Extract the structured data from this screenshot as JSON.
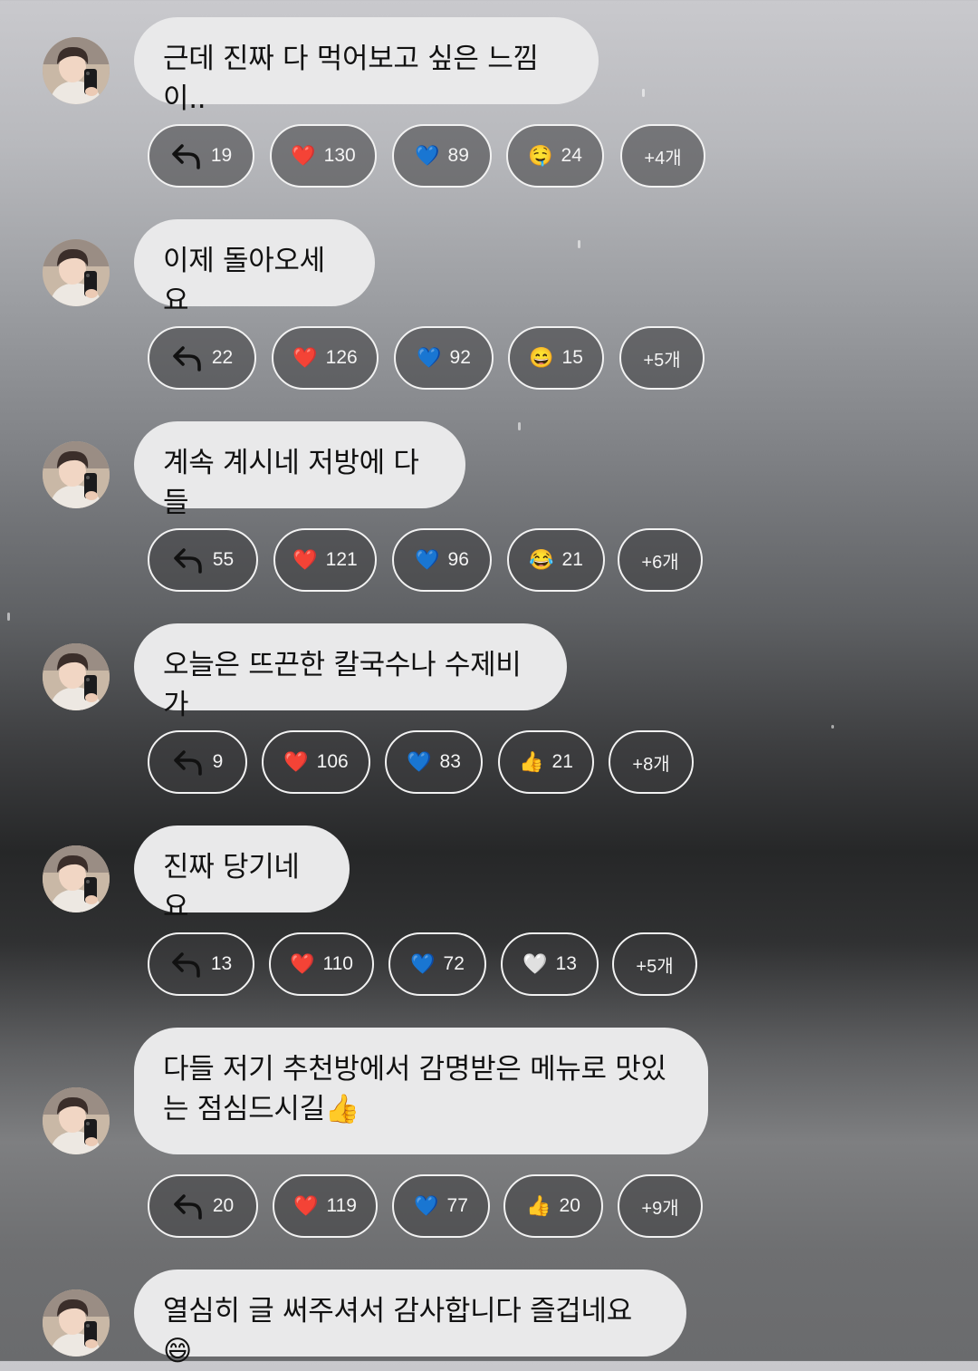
{
  "messages": [
    {
      "text": "근데 진짜 다 먹어보고 싶은 느낌이..",
      "reactions": [
        {
          "type": "reply",
          "icon": "reply-arrow-icon",
          "count": "19"
        },
        {
          "type": "emoji",
          "icon": "red-heart-icon",
          "emoji": "❤️",
          "count": "130"
        },
        {
          "type": "emoji",
          "icon": "blue-heart-icon",
          "emoji": "💙",
          "count": "89"
        },
        {
          "type": "emoji",
          "icon": "drooling-face-icon",
          "emoji": "🤤",
          "count": "24"
        },
        {
          "type": "more",
          "label": "+4개"
        }
      ]
    },
    {
      "text": "이제 돌아오세요",
      "reactions": [
        {
          "type": "reply",
          "icon": "reply-arrow-icon",
          "count": "22"
        },
        {
          "type": "emoji",
          "icon": "red-heart-icon",
          "emoji": "❤️",
          "count": "126"
        },
        {
          "type": "emoji",
          "icon": "blue-heart-icon",
          "emoji": "💙",
          "count": "92"
        },
        {
          "type": "emoji",
          "icon": "grinning-face-icon",
          "emoji": "😄",
          "count": "15"
        },
        {
          "type": "more",
          "label": "+5개"
        }
      ]
    },
    {
      "text": "계속 계시네 저방에 다들",
      "reactions": [
        {
          "type": "reply",
          "icon": "reply-arrow-icon",
          "count": "55"
        },
        {
          "type": "emoji",
          "icon": "red-heart-icon",
          "emoji": "❤️",
          "count": "121"
        },
        {
          "type": "emoji",
          "icon": "blue-heart-icon",
          "emoji": "💙",
          "count": "96"
        },
        {
          "type": "emoji",
          "icon": "tears-of-joy-icon",
          "emoji": "😂",
          "count": "21"
        },
        {
          "type": "more",
          "label": "+6개"
        }
      ]
    },
    {
      "text": "오늘은 뜨끈한 칼국수나 수제비가",
      "reactions": [
        {
          "type": "reply",
          "icon": "reply-arrow-icon",
          "count": "9"
        },
        {
          "type": "emoji",
          "icon": "red-heart-icon",
          "emoji": "❤️",
          "count": "106"
        },
        {
          "type": "emoji",
          "icon": "blue-heart-icon",
          "emoji": "💙",
          "count": "83"
        },
        {
          "type": "emoji",
          "icon": "thumbs-up-icon",
          "emoji": "👍",
          "count": "21"
        },
        {
          "type": "more",
          "label": "+8개"
        }
      ]
    },
    {
      "text": "진짜 당기네요",
      "reactions": [
        {
          "type": "reply",
          "icon": "reply-arrow-icon",
          "count": "13"
        },
        {
          "type": "emoji",
          "icon": "red-heart-icon",
          "emoji": "❤️",
          "count": "110"
        },
        {
          "type": "emoji",
          "icon": "blue-heart-icon",
          "emoji": "💙",
          "count": "72"
        },
        {
          "type": "emoji",
          "icon": "white-heart-icon",
          "emoji": "🤍",
          "count": "13"
        },
        {
          "type": "more",
          "label": "+5개"
        }
      ]
    },
    {
      "text": "다들 저기 추천방에서 감명받은 메뉴로 맛있는 점심드시길👍",
      "reactions": [
        {
          "type": "reply",
          "icon": "reply-arrow-icon",
          "count": "20"
        },
        {
          "type": "emoji",
          "icon": "red-heart-icon",
          "emoji": "❤️",
          "count": "119"
        },
        {
          "type": "emoji",
          "icon": "blue-heart-icon",
          "emoji": "💙",
          "count": "77"
        },
        {
          "type": "emoji",
          "icon": "thumbs-up-icon",
          "emoji": "👍",
          "count": "20"
        },
        {
          "type": "more",
          "label": "+9개"
        }
      ]
    },
    {
      "text": "열심히 글 써주셔서 감사합니다 즐겁네요😄",
      "reactions": []
    }
  ]
}
